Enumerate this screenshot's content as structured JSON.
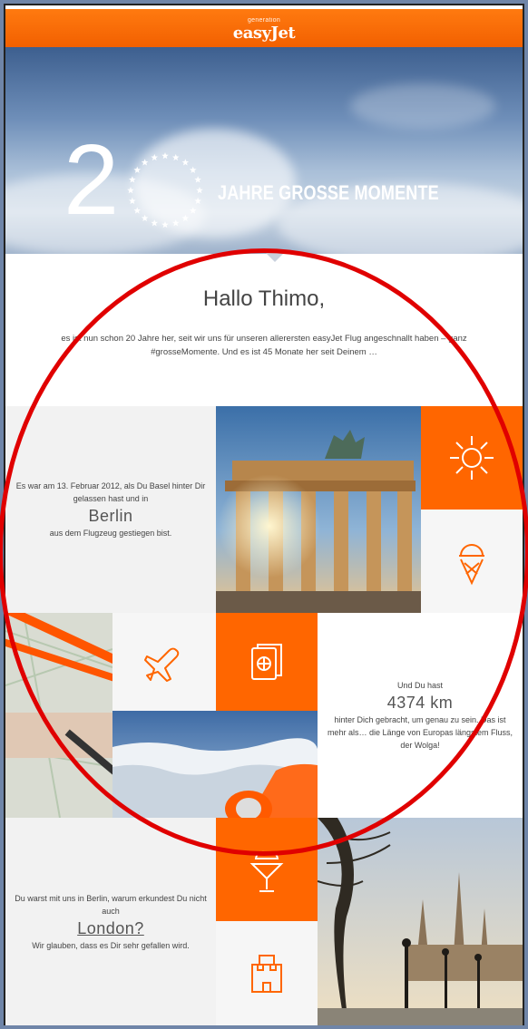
{
  "header": {
    "tag": "generation",
    "brand": "easyJet"
  },
  "hero": {
    "number": "2",
    "title": "JAHRE GROSSE MOMENTE"
  },
  "greeting": {
    "title": "Hallo Thimo,",
    "text": "es ist nun schon 20 Jahre her, seit wir uns für unseren allerersten easyJet Flug angeschnallt haben – ganz #grosseMomente. Und es ist 45 Monate her seit Deinem …"
  },
  "block1": {
    "pre": "Es war am 13. Februar 2012, als Du Basel hinter Dir gelassen hast und in",
    "city": "Berlin",
    "post": "aus dem Flugzeug gestiegen bist."
  },
  "block2": {
    "pre": "Und Du hast",
    "distance": "4374 km",
    "post": "hinter Dich gebracht, um genau zu sein. Das ist mehr als… die Länge von Europas längstem Fluss, der Wolga!"
  },
  "block3": {
    "pre": "Du warst mit uns in Berlin, warum erkundest Du nicht auch",
    "city": "London?",
    "post": "Wir glauben, dass es Dir sehr gefallen wird."
  },
  "icons": [
    "sun-icon",
    "ice-cream-icon",
    "airplane-icon",
    "passport-icon",
    "cocktail-icon",
    "castle-icon"
  ],
  "colors": {
    "brand": "#ff6600",
    "annotation": "#e00000"
  }
}
